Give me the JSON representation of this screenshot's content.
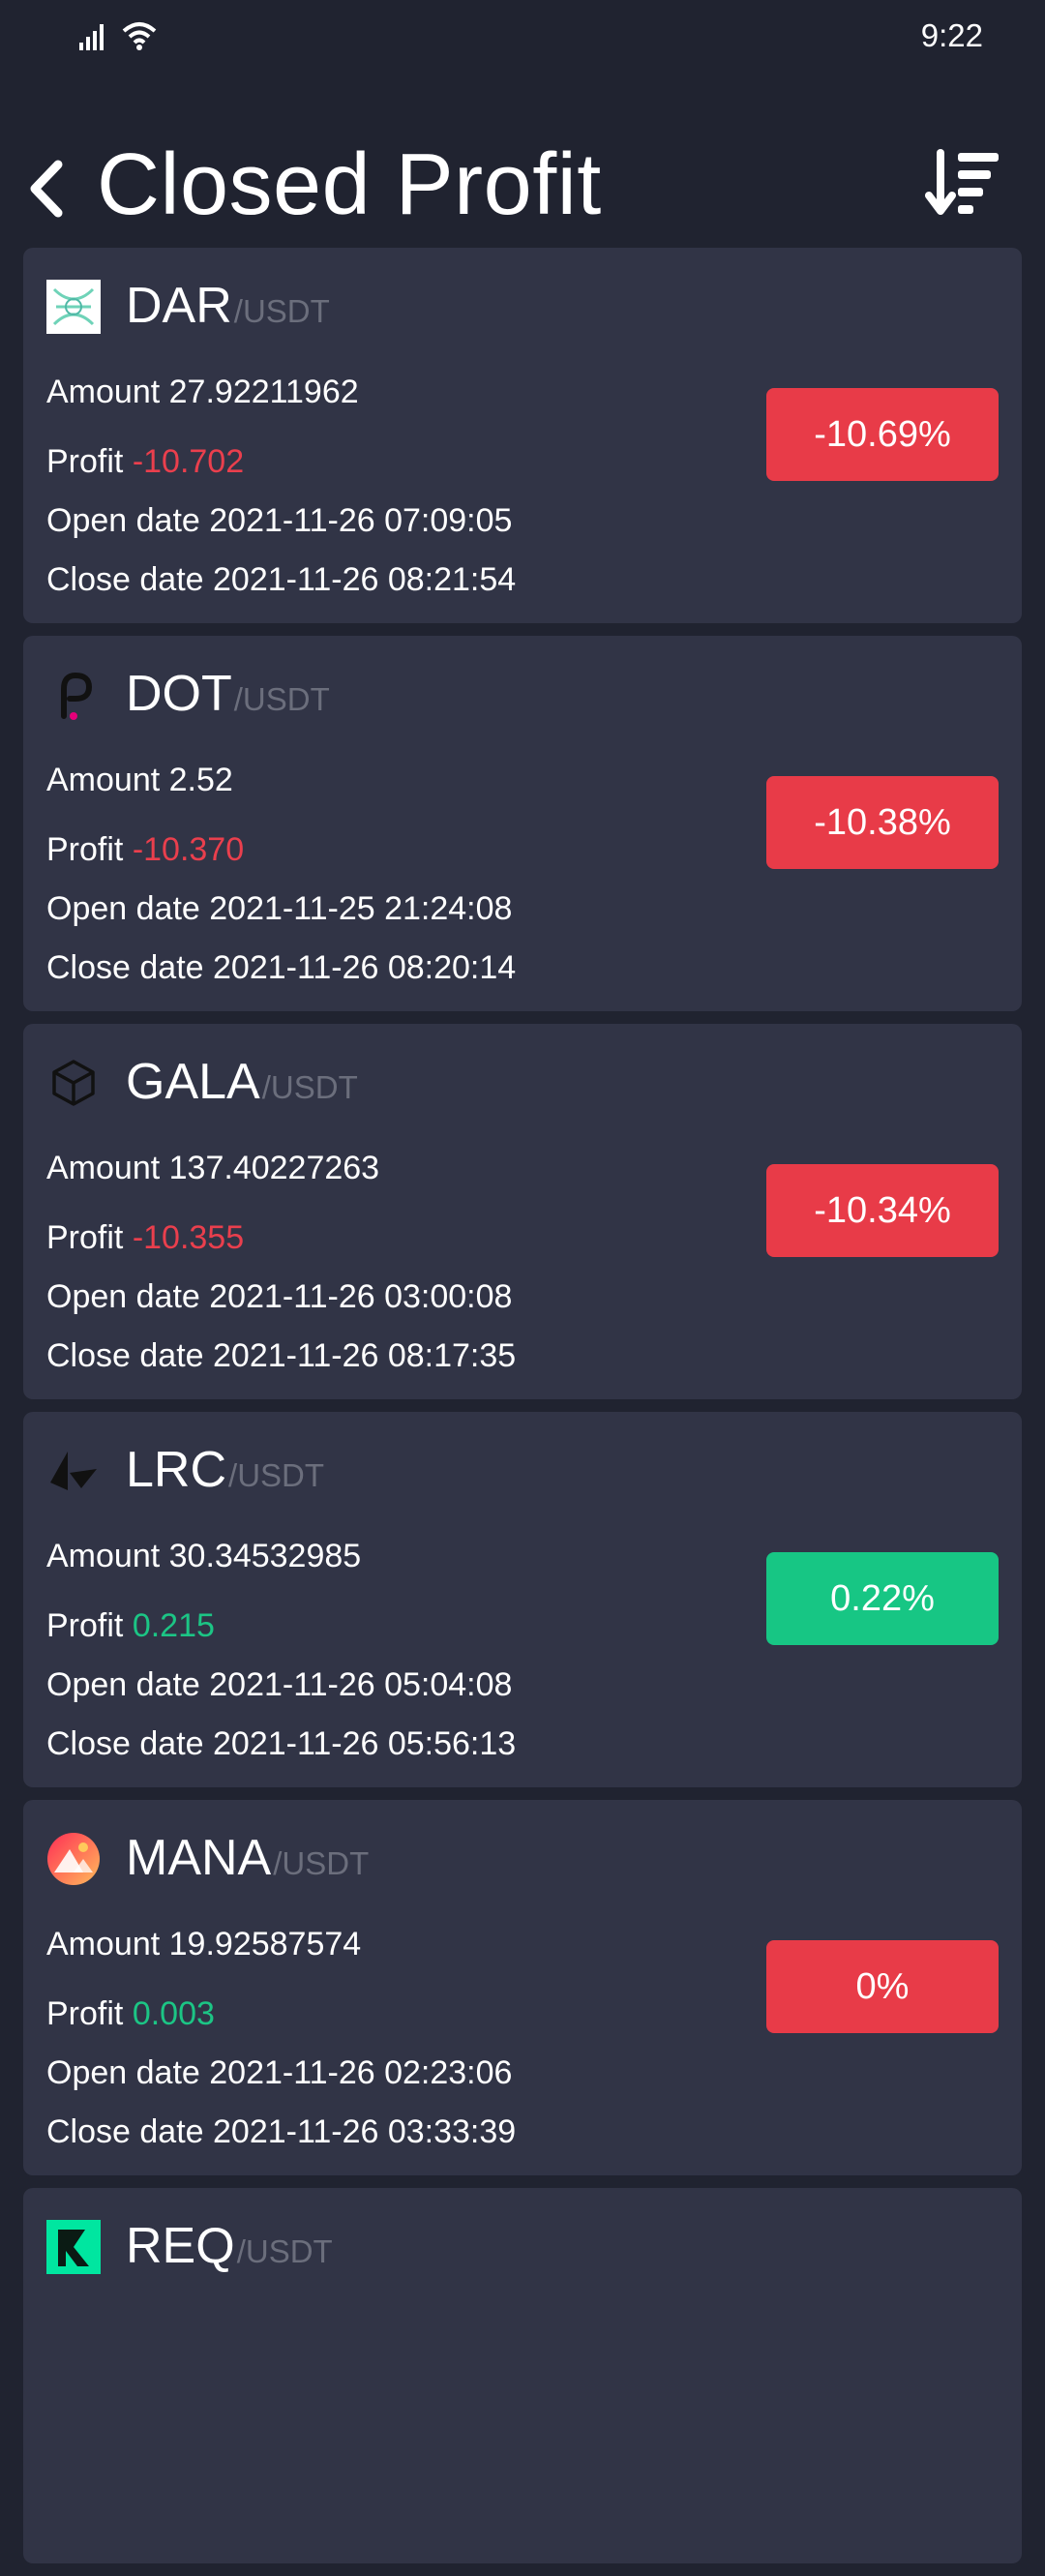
{
  "status": {
    "time": "9:22"
  },
  "header": {
    "title": "Closed Profit"
  },
  "labels": {
    "amount": "Amount",
    "profit": "Profit",
    "open_date": "Open date",
    "close_date": "Close date"
  },
  "colors": {
    "loss": "#ea3f4d",
    "gain": "#1cc585",
    "card_bg": "#313446",
    "page_bg": "#202330"
  },
  "positions": [
    {
      "symbol": "DAR",
      "quote": "/USDT",
      "icon": "dar-logo-icon",
      "amount": "27.92211962",
      "profit": "-10.702",
      "profit_dir": "loss",
      "open_date": "2021-11-26 07:09:05",
      "close_date": "2021-11-26 08:21:54",
      "percent": "-10.69%",
      "badge": "loss"
    },
    {
      "symbol": "DOT",
      "quote": "/USDT",
      "icon": "dot-logo-icon",
      "amount": "2.52",
      "profit": "-10.370",
      "profit_dir": "loss",
      "open_date": "2021-11-25 21:24:08",
      "close_date": "2021-11-26 08:20:14",
      "percent": "-10.38%",
      "badge": "loss"
    },
    {
      "symbol": "GALA",
      "quote": "/USDT",
      "icon": "gala-logo-icon",
      "amount": "137.40227263",
      "profit": "-10.355",
      "profit_dir": "loss",
      "open_date": "2021-11-26 03:00:08",
      "close_date": "2021-11-26 08:17:35",
      "percent": "-10.34%",
      "badge": "loss"
    },
    {
      "symbol": "LRC",
      "quote": "/USDT",
      "icon": "lrc-logo-icon",
      "amount": "30.34532985",
      "profit": "0.215",
      "profit_dir": "gain",
      "open_date": "2021-11-26 05:04:08",
      "close_date": "2021-11-26 05:56:13",
      "percent": "0.22%",
      "badge": "gain"
    },
    {
      "symbol": "MANA",
      "quote": "/USDT",
      "icon": "mana-logo-icon",
      "amount": "19.92587574",
      "profit": "0.003",
      "profit_dir": "gain",
      "open_date": "2021-11-26 02:23:06",
      "close_date": "2021-11-26 03:33:39",
      "percent": "0%",
      "badge": "loss"
    },
    {
      "symbol": "REQ",
      "quote": "/USDT",
      "icon": "req-logo-icon"
    }
  ]
}
